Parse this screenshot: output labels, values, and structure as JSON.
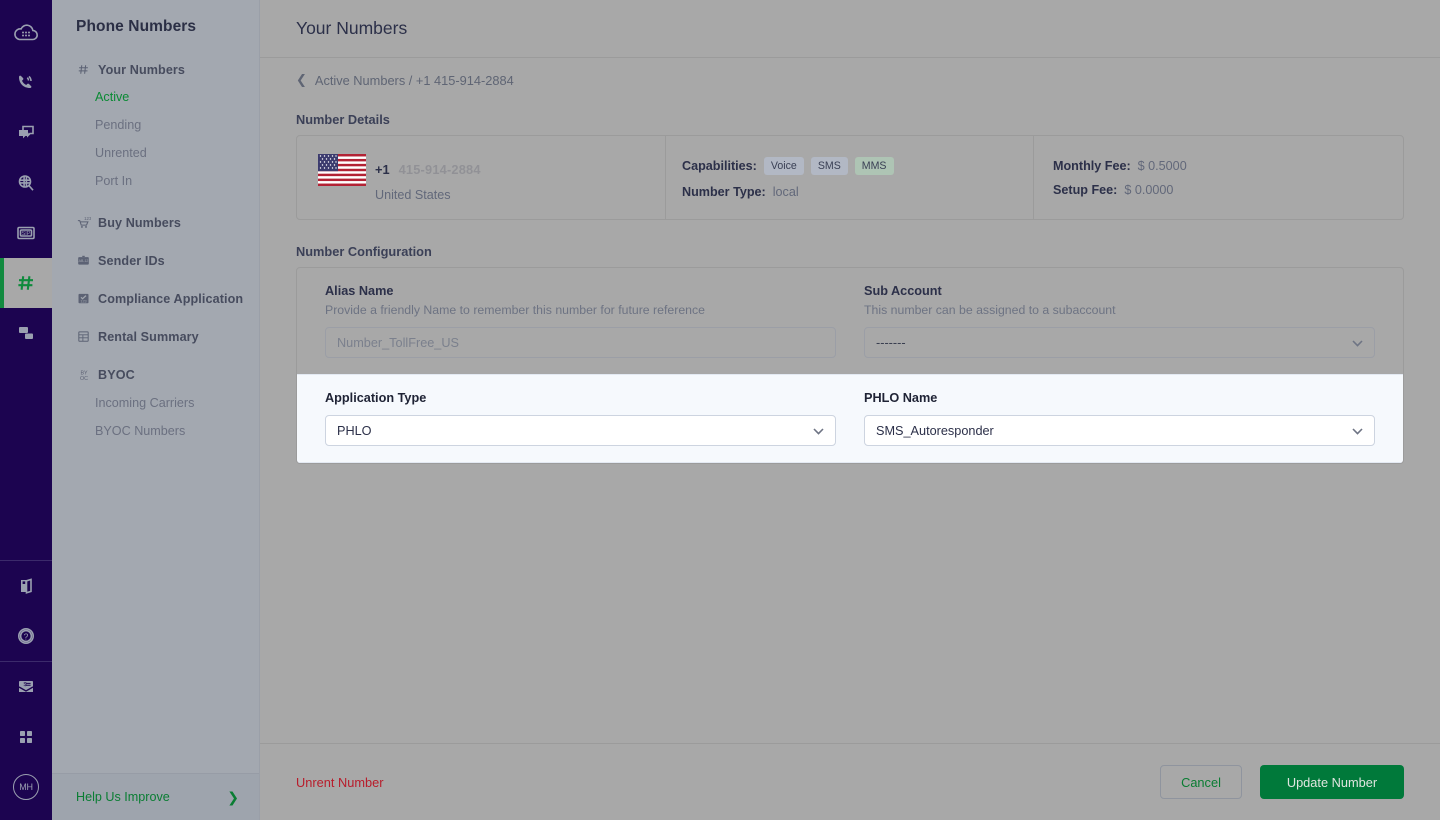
{
  "colors": {
    "rail_bg": "#1c0450",
    "accent_green": "#0a7d33",
    "button_green": "#00793a",
    "danger_red": "#b81c2b",
    "highlight_bg": "#f6f9fd"
  },
  "rail": {
    "items": [
      {
        "name": "cloud-icon",
        "label": "Overview"
      },
      {
        "name": "phone-signal-icon",
        "label": "Voice"
      },
      {
        "name": "messaging-icon",
        "label": "Messaging"
      },
      {
        "name": "lookup-search-icon",
        "label": "Lookup"
      },
      {
        "name": "sip-trunk-icon",
        "label": "SIP Trunking"
      },
      {
        "name": "hash-numbers-icon",
        "label": "Phone Numbers",
        "active": true
      },
      {
        "name": "flow-nodes-icon",
        "label": "PHLO"
      }
    ],
    "bottom_items": [
      {
        "name": "docs-book-icon",
        "label": "Docs"
      },
      {
        "name": "help-question-icon",
        "label": "Help"
      },
      {
        "name": "billing-envelope-icon",
        "label": "Billing"
      },
      {
        "name": "apps-grid-icon",
        "label": "Apps"
      },
      {
        "name": "avatar",
        "label": "MH"
      }
    ]
  },
  "sidebar": {
    "title": "Phone Numbers",
    "groups": [
      {
        "icon": "hash-icon",
        "label": "Your Numbers",
        "children": [
          {
            "label": "Active",
            "selected": true
          },
          {
            "label": "Pending",
            "selected": false
          },
          {
            "label": "Unrented",
            "selected": false
          },
          {
            "label": "Port In",
            "selected": false
          }
        ]
      },
      {
        "icon": "cart-123-icon",
        "label": "Buy Numbers",
        "children": []
      },
      {
        "icon": "sender-id-icon",
        "label": "Sender IDs",
        "children": []
      },
      {
        "icon": "compliance-123-icon",
        "label": "Compliance Application",
        "children": []
      },
      {
        "icon": "table-grid-icon",
        "label": "Rental Summary",
        "children": []
      },
      {
        "icon": "byoc-icon",
        "label": "BYOC",
        "children": [
          {
            "label": "Incoming Carriers",
            "selected": false
          },
          {
            "label": "BYOC Numbers",
            "selected": false
          }
        ]
      }
    ],
    "help": {
      "label": "Help Us Improve",
      "chevron": "❯"
    }
  },
  "main": {
    "title": "Your Numbers",
    "breadcrumb": {
      "back_icon": "chevron-left-icon",
      "text": "Active Numbers / +1 415-914-2884"
    },
    "number_details": {
      "section_title": "Number Details",
      "flag": "us-flag-icon",
      "number_prefix": "+1",
      "number": "415-914-2884",
      "country": "United States",
      "capabilities_label": "Capabilities:",
      "capabilities": [
        "Voice",
        "SMS",
        "MMS"
      ],
      "number_type_label": "Number Type:",
      "number_type_value": "local",
      "monthly_fee_label": "Monthly Fee:",
      "monthly_fee_value": "$ 0.5000",
      "setup_fee_label": "Setup Fee:",
      "setup_fee_value": "$ 0.0000"
    },
    "number_configuration": {
      "section_title": "Number Configuration",
      "alias": {
        "label": "Alias Name",
        "hint": "Provide a friendly Name to remember this number for future reference",
        "value": "",
        "placeholder": "Number_TollFree_US"
      },
      "sub_account": {
        "label": "Sub Account",
        "hint": "This number can be assigned to a subaccount",
        "value": "-------"
      },
      "application_type": {
        "label": "Application Type",
        "value": "PHLO"
      },
      "phlo_name": {
        "label": "PHLO Name",
        "value": "SMS_Autoresponder"
      }
    },
    "footer": {
      "unrent_label": "Unrent Number",
      "cancel_label": "Cancel",
      "update_label": "Update Number"
    }
  }
}
